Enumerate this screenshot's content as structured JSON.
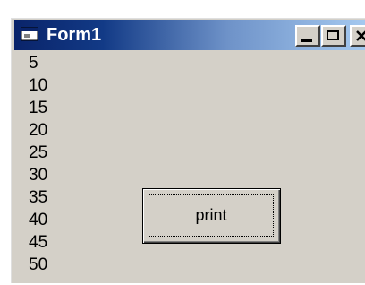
{
  "window": {
    "title": "Form1",
    "controls": {
      "minimize_icon": "minimize-icon",
      "maximize_icon": "maximize-icon",
      "close_icon": "close-icon"
    }
  },
  "output": {
    "lines": [
      "5",
      "10",
      "15",
      "20",
      "25",
      "30",
      "35",
      "40",
      "45",
      "50"
    ]
  },
  "print_button": {
    "label": "print"
  },
  "colors": {
    "titlebar_start": "#0a246a",
    "titlebar_end": "#a6caf0",
    "face": "#d4d0c8"
  }
}
